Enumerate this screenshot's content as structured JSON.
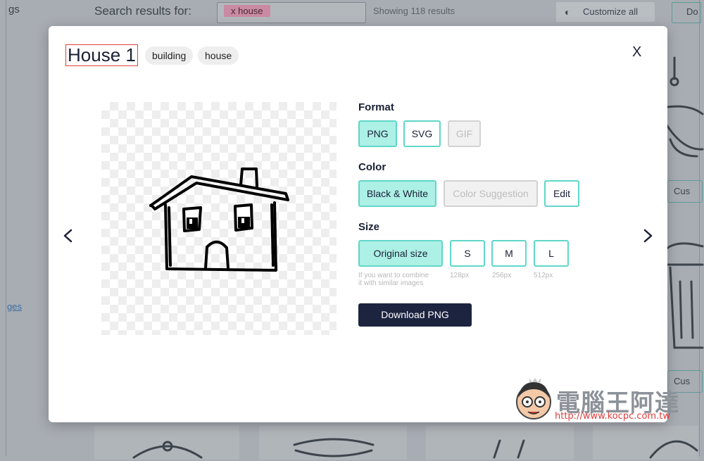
{
  "background": {
    "side_text": "gs",
    "search_label": "Search results for:",
    "search_chip": "x house",
    "results_count": "Showing 118 results",
    "customize_all": "Customize all",
    "right_button": "Do",
    "cust_label": "Cus",
    "side_link": "ges"
  },
  "modal": {
    "title": "House 1",
    "tags": [
      "building",
      "house"
    ],
    "close_label": "X",
    "format": {
      "label": "Format",
      "options": [
        "PNG",
        "SVG",
        "GIF"
      ],
      "selected": "PNG",
      "disabled": "GIF"
    },
    "color": {
      "label": "Color",
      "options": [
        "Black & White",
        "Color Suggestion",
        "Edit"
      ],
      "selected": "Black & White",
      "disabled": "Color Suggestion"
    },
    "size": {
      "label": "Size",
      "options": [
        "Original size",
        "S",
        "M",
        "L"
      ],
      "selected": "Original size",
      "hints": [
        "If you want to combine\nit with similar images",
        "128px",
        "256px",
        "512px"
      ]
    },
    "download_label": "Download PNG"
  },
  "watermark": {
    "brand": "電腦王阿達",
    "url": "http://www.kocpc.com.tw"
  },
  "colors": {
    "accent": "#5fd7c9",
    "accent_fill": "#adf0e6",
    "primary_button": "#1c2440",
    "title_border": "#e0413b"
  }
}
